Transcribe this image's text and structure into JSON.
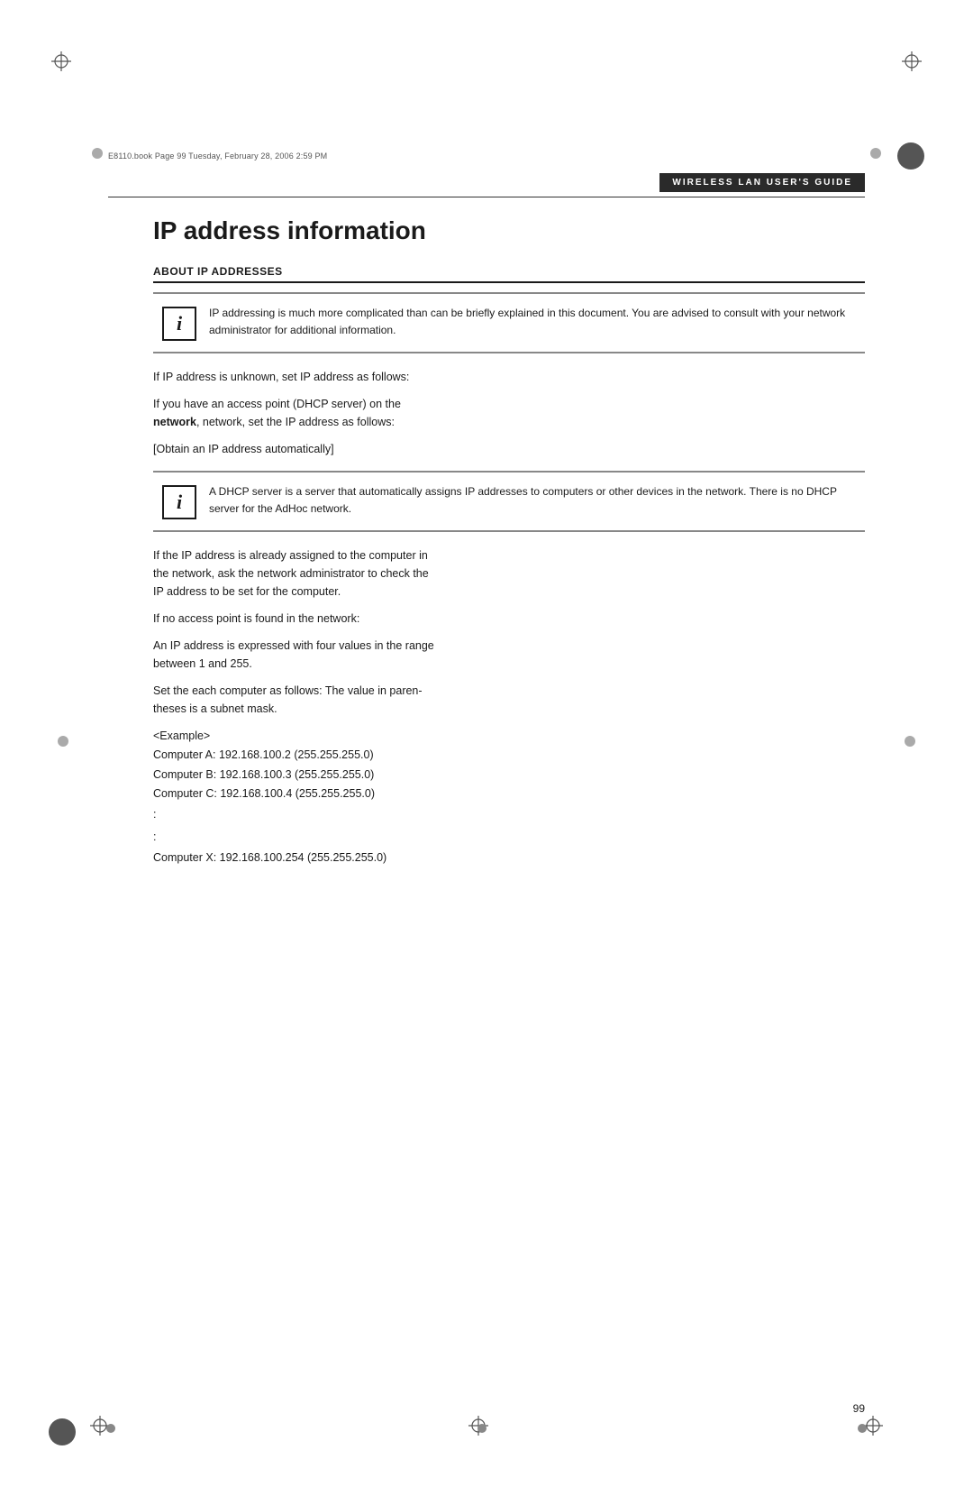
{
  "meta": {
    "file_info": "E8110.book  Page 99  Tuesday, February 28, 2006  2:59 PM"
  },
  "header": {
    "title": "Wireless LAN User's Guide"
  },
  "page": {
    "number": "99",
    "title": "IP address information",
    "section_heading": "ABOUT IP ADDRESSES",
    "info_box_1": {
      "icon": "i",
      "text": "IP addressing is much more complicated than can be briefly explained in this document. You are advised to consult with your network administrator for additional information."
    },
    "paragraph_1": "If IP address is unknown, set IP address as follows:",
    "paragraph_2a": "If you have an access point (DHCP server) on the",
    "paragraph_2b": "network, set the IP address as follows:",
    "bracket_text": "[Obtain an IP address automatically]",
    "info_box_2": {
      "icon": "i",
      "text": "A DHCP server is a server that automatically assigns IP addresses to computers or other devices in the network. There is no DHCP server for the AdHoc network."
    },
    "paragraph_3a": "If the IP address is already assigned to the computer in",
    "paragraph_3b": "the network, ask the network administrator to check the",
    "paragraph_3c": "IP address to be set for the computer.",
    "paragraph_4": "If no access point is found in the network:",
    "paragraph_5a": "An IP address is expressed with four values in the range",
    "paragraph_5b": "between 1 and 255.",
    "paragraph_6a": "Set the each computer as follows: The value in paren-",
    "paragraph_6b": "theses is a subnet mask.",
    "example_label": "<Example>",
    "computer_a": "Computer A: 192.168.100.2 (255.255.255.0)",
    "computer_b": "Computer B: 192.168.100.3 (255.255.255.0)",
    "computer_c": "Computer C: 192.168.100.4 (255.255.255.0)",
    "dots_1": ":",
    "dots_2": ":",
    "computer_x": "Computer X: 192.168.100.254 (255.255.255.0)"
  }
}
